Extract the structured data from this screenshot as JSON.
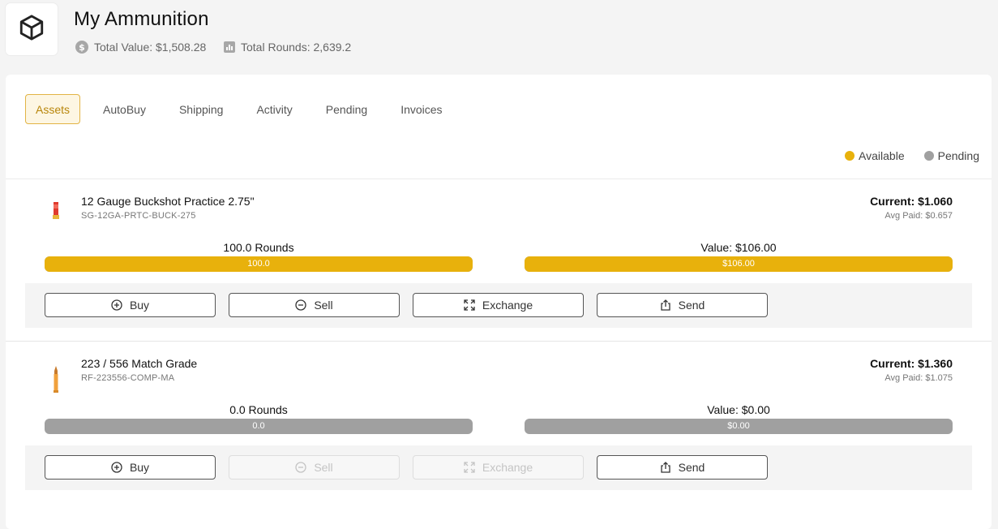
{
  "header": {
    "title": "My Ammunition",
    "total_value_label": "Total Value: $1,508.28",
    "total_rounds_label": "Total Rounds: 2,639.2"
  },
  "icons": {
    "logo": "cube-icon",
    "value": "dollar-circle-icon",
    "rounds": "bar-chart-icon",
    "buy": "plus-circle-icon",
    "sell": "minus-circle-icon",
    "exchange": "expand-arrows-icon",
    "send": "share-upload-icon"
  },
  "tabs": [
    {
      "label": "Assets",
      "active": true
    },
    {
      "label": "AutoBuy",
      "active": false
    },
    {
      "label": "Shipping",
      "active": false
    },
    {
      "label": "Activity",
      "active": false
    },
    {
      "label": "Pending",
      "active": false
    },
    {
      "label": "Invoices",
      "active": false
    }
  ],
  "legend": {
    "available": {
      "label": "Available",
      "color": "#e8b10c"
    },
    "pending": {
      "label": "Pending",
      "color": "#a0a0a0"
    }
  },
  "assets": [
    {
      "name": "12 Gauge Buckshot Practice 2.75\"",
      "sku": "SG-12GA-PRTC-BUCK-275",
      "current": "Current: $1.060",
      "avg_paid": "Avg Paid: $0.657",
      "rounds_title": "100.0 Rounds",
      "rounds_bar_label": "100.0",
      "rounds_available_fraction": 1.0,
      "value_title": "Value: $106.00",
      "value_bar_label": "$106.00",
      "value_available_fraction": 1.0,
      "buttons": {
        "buy": "Buy",
        "sell": "Sell",
        "exchange": "Exchange",
        "send": "Send"
      },
      "sell_enabled": true,
      "exchange_enabled": true
    },
    {
      "name": "223 / 556 Match Grade",
      "sku": "RF-223556-COMP-MA",
      "current": "Current: $1.360",
      "avg_paid": "Avg Paid: $1.075",
      "rounds_title": "0.0 Rounds",
      "rounds_bar_label": "0.0",
      "rounds_available_fraction": 0.0,
      "value_title": "Value: $0.00",
      "value_bar_label": "$0.00",
      "value_available_fraction": 0.0,
      "buttons": {
        "buy": "Buy",
        "sell": "Sell",
        "exchange": "Exchange",
        "send": "Send"
      },
      "sell_enabled": false,
      "exchange_enabled": false
    }
  ]
}
